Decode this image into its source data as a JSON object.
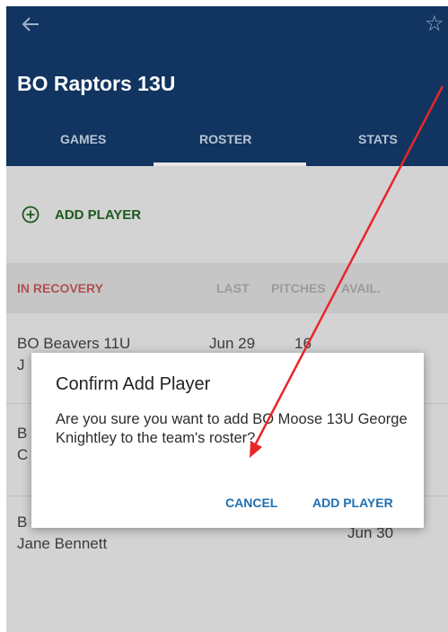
{
  "header": {
    "title": "BO Raptors 13U",
    "tabs": [
      {
        "label": "GAMES"
      },
      {
        "label": "ROSTER"
      },
      {
        "label": "STATS"
      }
    ],
    "back_icon": "back-arrow-icon",
    "star_icon": "star-icon"
  },
  "add_player": {
    "label": "ADD PLAYER",
    "icon": "plus-circle-icon"
  },
  "table": {
    "section_label": "IN RECOVERY",
    "columns": [
      "LAST",
      "PITCHES",
      "AVAIL."
    ],
    "rows": [
      {
        "line1": "BO Beavers 11U",
        "line2": "J",
        "last": "Jun 29",
        "pitches": "16"
      },
      {
        "line1": "B",
        "line2": "C"
      },
      {
        "line1": "B",
        "line2": "Jane Bennett",
        "avail": "Jun 30"
      }
    ]
  },
  "dialog": {
    "title": "Confirm Add Player",
    "message": "Are you sure you want to add BO Moose 13U George Knightley to the team's roster?",
    "cancel_label": "CANCEL",
    "confirm_label": "ADD PLAYER"
  },
  "colors": {
    "appbar": "#113460",
    "accent_blue": "#1f6fb0",
    "add_green": "#1c5a1c",
    "recovery_red": "#b05050",
    "annotation_red": "#e8262a"
  }
}
